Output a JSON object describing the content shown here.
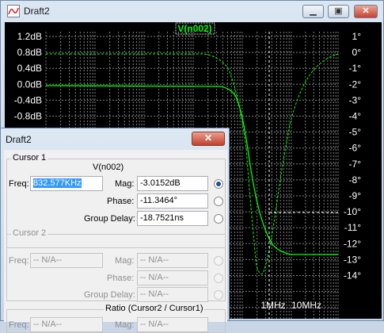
{
  "window": {
    "title": "Draft2"
  },
  "trace": {
    "name": "V(n002)"
  },
  "left_axis": {
    "ticks": [
      "1.2dB",
      "0.8dB",
      "0.4dB",
      "0.0dB",
      "-0.4dB",
      "-0.8dB"
    ]
  },
  "right_axis": {
    "ticks": [
      "1°",
      "0°",
      "-1°",
      "-2°",
      "-3°",
      "-4°",
      "-5°",
      "-6°",
      "-7°",
      "-8°",
      "-9°",
      "-10°",
      "-11°",
      "-12°",
      "-13°",
      "-14°"
    ]
  },
  "x_axis": {
    "visible_ticks": [
      "1MHz",
      "10MHz"
    ]
  },
  "colors": {
    "trace": "#00ff00",
    "background": "#000000",
    "grid": "#808080"
  },
  "dialog": {
    "title": "Draft2",
    "close_glyph": "✕",
    "cursor1": {
      "group": "Cursor 1",
      "trace": "V(n002)",
      "freq_label": "Freq:",
      "freq_value": "832.577KHz",
      "mag_label": "Mag:",
      "mag_value": "-3.0152dB",
      "phase_label": "Phase:",
      "phase_value": "-11.3464°",
      "gd_label": "Group Delay:",
      "gd_value": "-18.7521ns"
    },
    "cursor2": {
      "group": "Cursor 2",
      "freq_label": "Freq:",
      "freq_value": "-- N/A--",
      "mag_label": "Mag:",
      "mag_value": "-- N/A--",
      "phase_label": "Phase:",
      "phase_value": "-- N/A--",
      "gd_label": "Group Delay:",
      "gd_value": "-- N/A--"
    },
    "ratio": {
      "group": "Ratio (Cursor2 / Cursor1)",
      "freq_label": "Freq:",
      "freq_value": "-- N/A--",
      "mag_label": "Mag:",
      "mag_value": "-- N/A--"
    }
  }
}
